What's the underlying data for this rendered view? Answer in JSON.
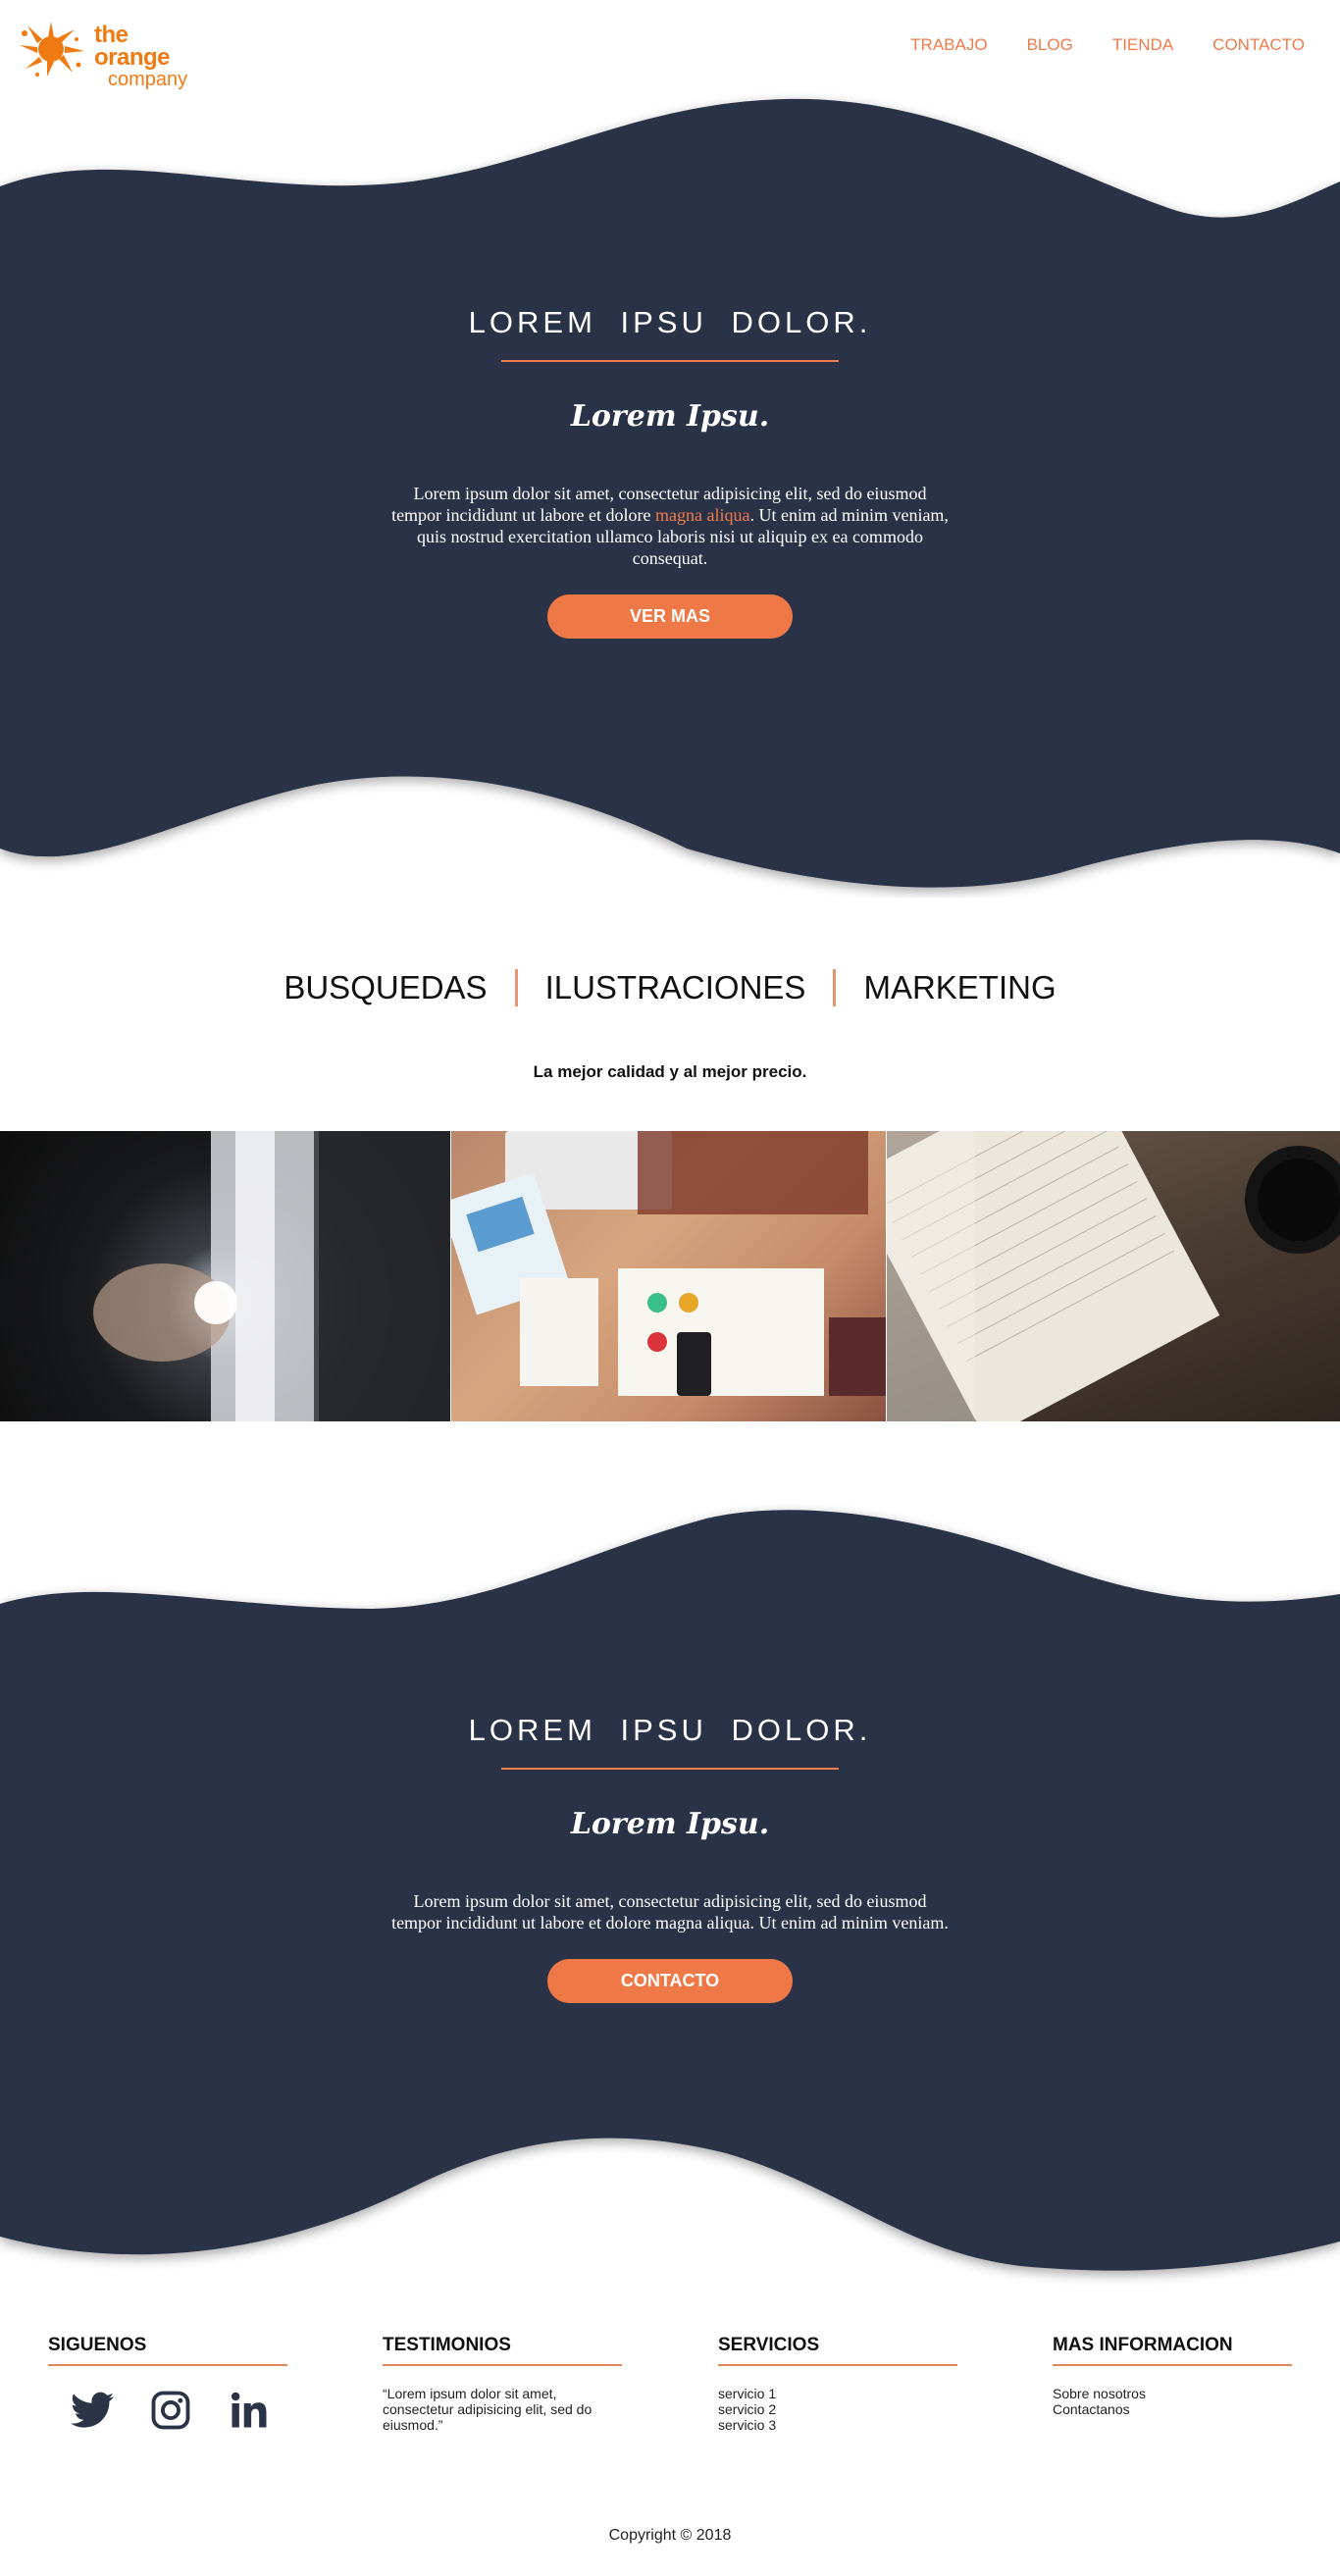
{
  "brand": {
    "line1": "the orange",
    "line2": "company",
    "color": "#f07a12",
    "icon": "orange-splash-icon"
  },
  "nav": {
    "items": [
      {
        "label": "TRABAJO"
      },
      {
        "label": "BLOG"
      },
      {
        "label": "TIENDA"
      },
      {
        "label": "CONTACTO"
      }
    ]
  },
  "hero": {
    "title": "LOREM  IPSU  DOLOR.",
    "subtitle": "Lorem Ipsu.",
    "text_before": "Lorem ipsum dolor sit amet, consectetur adipisicing elit, sed do eiusmod tempor incididunt ut labore et dolore ",
    "text_highlight": "magna aliqua",
    "text_after": ". Ut enim ad minim veniam, quis nostrud exercitation ullamco laboris nisi ut aliquip ex ea commodo consequat.",
    "button": "VER MAS"
  },
  "categories": {
    "items": [
      "BUSQUEDAS",
      "ILUSTRACIONES",
      "MARKETING"
    ],
    "tagline": "La mejor calidad y al mejor precio."
  },
  "gallery": {
    "images": [
      "man-pointing-photo",
      "desk-workspace-photo",
      "notebook-coffee-photo"
    ]
  },
  "cta": {
    "title": "LOREM  IPSU  DOLOR.",
    "subtitle": "Lorem Ipsu.",
    "text": "Lorem ipsum dolor sit amet, consectetur adipisicing elit, sed do eiusmod tempor incididunt ut labore et dolore magna aliqua. Ut enim ad minim veniam.",
    "button": "CONTACTO"
  },
  "footer": {
    "follow": {
      "title": "SIGUENOS",
      "icons": [
        "twitter-icon",
        "instagram-icon",
        "linkedin-icon"
      ]
    },
    "testimonials": {
      "title": "TESTIMONIOS",
      "quote": "“Lorem ipsum dolor sit amet, consectetur adipisicing elit, sed do eiusmod.”"
    },
    "services": {
      "title": "SERVICIOS",
      "items": [
        "servicio 1",
        "servicio 2",
        "servicio 3"
      ]
    },
    "info": {
      "title": "MAS INFORMACION",
      "items": [
        "Sobre nosotros",
        "Contactanos"
      ]
    },
    "copyright": "Copyright © 2018"
  },
  "colors": {
    "navy": "#2b3347",
    "accent": "#ef7b4a"
  }
}
